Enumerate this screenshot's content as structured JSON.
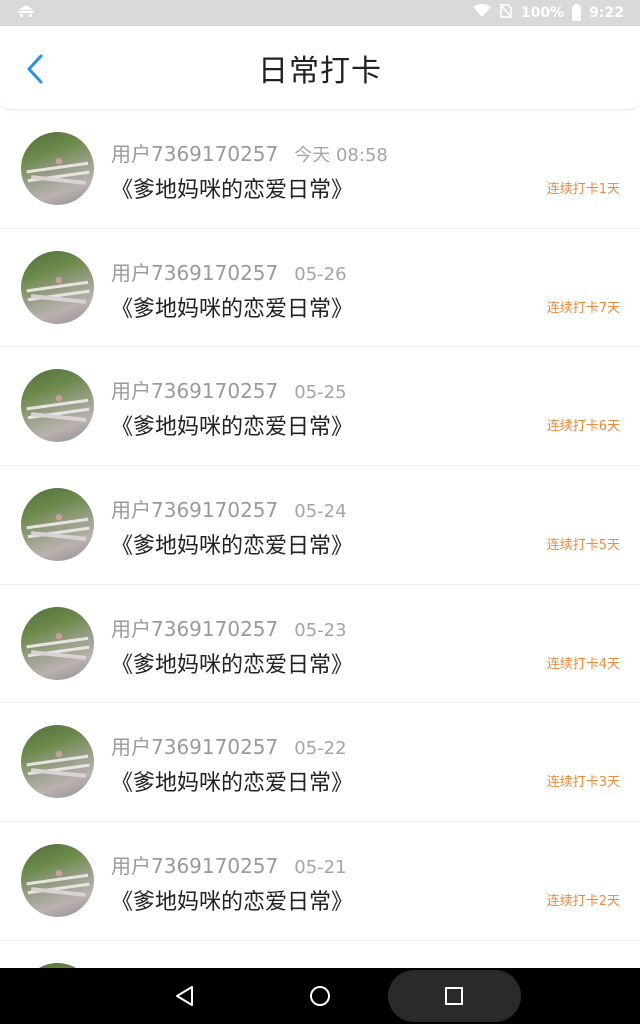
{
  "status_bar": {
    "battery": "100%",
    "time": "9:22",
    "icons": [
      "app-notification-icon",
      "wifi-icon",
      "no-sim-icon",
      "battery-icon"
    ]
  },
  "header": {
    "title": "日常打卡",
    "back_icon": "chevron-left-icon",
    "accent": "#2a93e0"
  },
  "checkins": [
    {
      "user": "用户7369170257",
      "date": "今天 08:58",
      "book": "《爹地妈咪的恋爱日常》",
      "streak": "连续打卡1天"
    },
    {
      "user": "用户7369170257",
      "date": "05-26",
      "book": "《爹地妈咪的恋爱日常》",
      "streak": "连续打卡7天"
    },
    {
      "user": "用户7369170257",
      "date": "05-25",
      "book": "《爹地妈咪的恋爱日常》",
      "streak": "连续打卡6天"
    },
    {
      "user": "用户7369170257",
      "date": "05-24",
      "book": "《爹地妈咪的恋爱日常》",
      "streak": "连续打卡5天"
    },
    {
      "user": "用户7369170257",
      "date": "05-23",
      "book": "《爹地妈咪的恋爱日常》",
      "streak": "连续打卡4天"
    },
    {
      "user": "用户7369170257",
      "date": "05-22",
      "book": "《爹地妈咪的恋爱日常》",
      "streak": "连续打卡3天"
    },
    {
      "user": "用户7369170257",
      "date": "05-21",
      "book": "《爹地妈咪的恋爱日常》",
      "streak": "连续打卡2天"
    }
  ],
  "colors": {
    "streak": "#f08a3c",
    "meta_text": "#9a9a9a",
    "status_bar": "#d9d9d9"
  },
  "nav_bar": {
    "icons": [
      "back-triangle-icon",
      "home-circle-icon",
      "recents-square-icon"
    ]
  }
}
